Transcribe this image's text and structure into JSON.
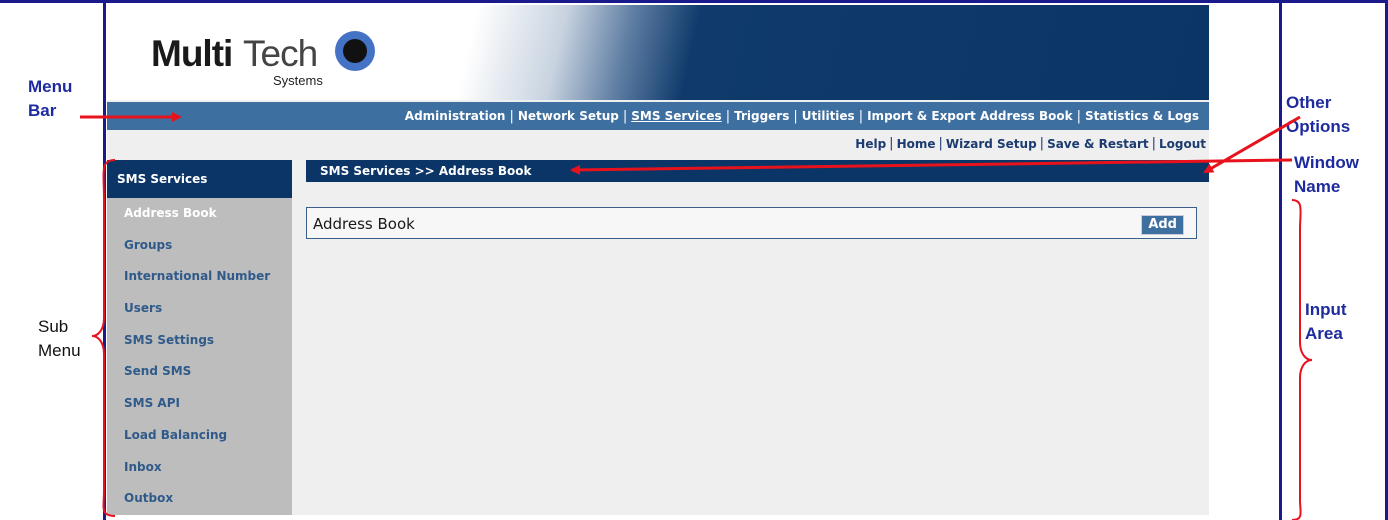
{
  "annotations": {
    "menu_bar": [
      "Menu",
      "Bar"
    ],
    "other_options": [
      "Other",
      "Options"
    ],
    "window_name": [
      "Window",
      "Name"
    ],
    "sub_menu": [
      "Sub",
      "Menu"
    ],
    "input_area": [
      "Input",
      "Area"
    ]
  },
  "logo": {
    "multi": "Multi",
    "tech": "Tech",
    "systems": "Systems"
  },
  "menu": {
    "items": [
      {
        "label": "Administration",
        "active": false
      },
      {
        "label": "Network Setup",
        "active": false
      },
      {
        "label": "SMS Services",
        "active": true
      },
      {
        "label": "Triggers",
        "active": false
      },
      {
        "label": "Utilities",
        "active": false
      },
      {
        "label": "Import & Export Address Book",
        "active": false
      },
      {
        "label": "Statistics & Logs",
        "active": false
      }
    ]
  },
  "options": [
    "Help",
    "Home",
    "Wizard Setup",
    "Save & Restart",
    "Logout"
  ],
  "sidebar": {
    "title": "SMS Services",
    "items": [
      {
        "label": "Address Book",
        "active": true
      },
      {
        "label": "Groups",
        "active": false
      },
      {
        "label": "International Number",
        "active": false
      },
      {
        "label": "Users",
        "active": false
      },
      {
        "label": "SMS Settings",
        "active": false
      },
      {
        "label": "Send SMS",
        "active": false
      },
      {
        "label": "SMS API",
        "active": false
      },
      {
        "label": "Load Balancing",
        "active": false
      },
      {
        "label": "Inbox",
        "active": false
      },
      {
        "label": "Outbox",
        "active": false
      }
    ]
  },
  "window": {
    "title": "SMS Services >> Address Book"
  },
  "panel": {
    "title": "Address Book",
    "add_label": "Add"
  },
  "colors": {
    "navy": "#0b3566",
    "menu_blue": "#3e6fa1",
    "annotation_red": "#e8121c",
    "annotation_blue": "#1e2b9e"
  }
}
